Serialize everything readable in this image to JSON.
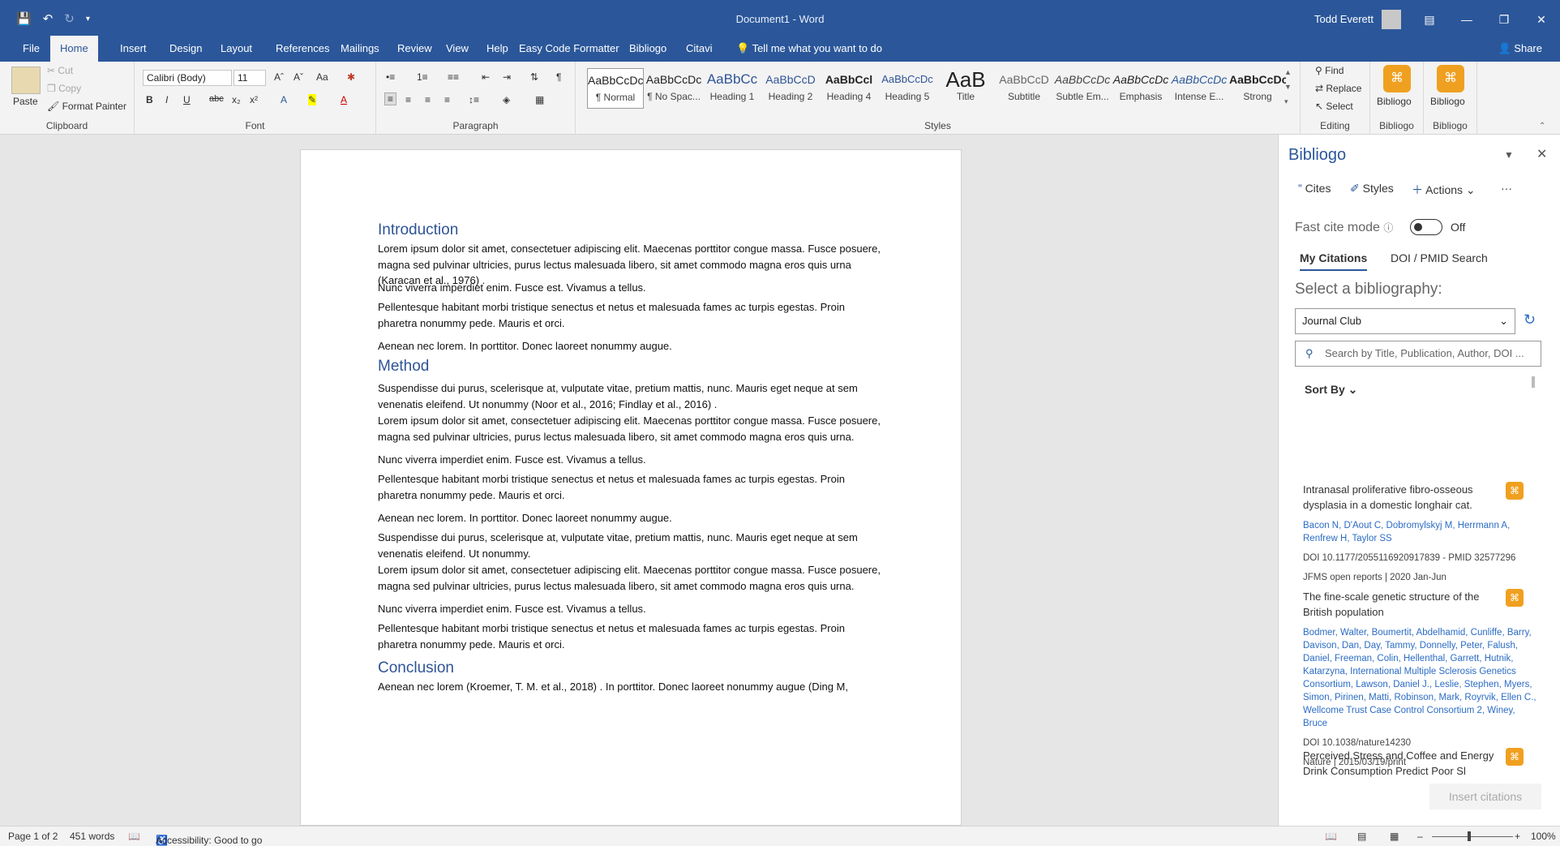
{
  "titlebar": {
    "document_title": "Document1 - Word",
    "user_name": "Todd Everett"
  },
  "tabs": [
    "File",
    "Home",
    "Insert",
    "Design",
    "Layout",
    "References",
    "Mailings",
    "Review",
    "View",
    "Help",
    "Easy Code Formatter",
    "Bibliogo",
    "Citavi"
  ],
  "tell_me": "Tell me what you want to do",
  "share": "Share",
  "ribbon": {
    "clipboard": {
      "paste": "Paste",
      "cut": "Cut",
      "copy": "Copy",
      "format_painter": "Format Painter",
      "label": "Clipboard"
    },
    "font": {
      "name": "Calibri (Body)",
      "size": "11",
      "label": "Font",
      "change_case": "Aa",
      "bold": "B",
      "italic": "I",
      "underline": "U"
    },
    "paragraph": {
      "label": "Paragraph"
    },
    "styles": {
      "label": "Styles",
      "items": [
        {
          "sample": "AaBbCcDc",
          "name": "¶ Normal"
        },
        {
          "sample": "AaBbCcDc",
          "name": "¶ No Spac..."
        },
        {
          "sample": "AaBbCc",
          "name": "Heading 1"
        },
        {
          "sample": "AaBbCcD",
          "name": "Heading 2"
        },
        {
          "sample": "AaBbCcl",
          "name": "Heading 4"
        },
        {
          "sample": "AaBbCcDc",
          "name": "Heading 5"
        },
        {
          "sample": "AaB",
          "name": "Title"
        },
        {
          "sample": "AaBbCcD",
          "name": "Subtitle"
        },
        {
          "sample": "AaBbCcDc",
          "name": "Subtle Em..."
        },
        {
          "sample": "AaBbCcDc",
          "name": "Emphasis"
        },
        {
          "sample": "AaBbCcDc",
          "name": "Intense E..."
        },
        {
          "sample": "AaBbCcDc",
          "name": "Strong"
        }
      ]
    },
    "editing": {
      "find": "Find",
      "replace": "Replace",
      "select": "Select",
      "label": "Editing"
    },
    "bibliogo1": {
      "button": "Bibliogo",
      "label": "Bibliogo"
    },
    "bibliogo2": {
      "button": "Bibliogo",
      "label": "Bibliogo"
    }
  },
  "document": {
    "blocks": [
      {
        "type": "h",
        "text": "Introduction"
      },
      {
        "type": "p",
        "text": "Lorem ipsum dolor sit amet, consectetuer adipiscing elit. Maecenas porttitor congue massa. Fusce posuere, magna sed pulvinar ultricies, purus lectus malesuada libero, sit amet commodo magna eros quis urna (Karacan et al., 1976) ."
      },
      {
        "type": "p",
        "text": "Nunc viverra imperdiet enim. Fusce est. Vivamus a tellus."
      },
      {
        "type": "p",
        "text": "Pellentesque habitant morbi tristique senectus et netus et malesuada fames ac turpis egestas. Proin pharetra nonummy pede. Mauris et orci."
      },
      {
        "type": "p",
        "text": "Aenean nec lorem. In porttitor. Donec laoreet nonummy augue."
      },
      {
        "type": "h",
        "text": "Method"
      },
      {
        "type": "p",
        "text": "Suspendisse dui purus, scelerisque at, vulputate vitae, pretium mattis, nunc. Mauris eget neque at sem venenatis eleifend. Ut nonummy (Noor et al., 2016; Findlay et al., 2016) ."
      },
      {
        "type": "p",
        "text": "Lorem ipsum dolor sit amet, consectetuer adipiscing elit. Maecenas porttitor congue massa. Fusce posuere, magna sed pulvinar ultricies, purus lectus malesuada libero, sit amet commodo magna eros quis urna."
      },
      {
        "type": "p",
        "text": "Nunc viverra imperdiet enim. Fusce est. Vivamus a tellus."
      },
      {
        "type": "p",
        "text": "Pellentesque habitant morbi tristique senectus et netus et malesuada fames ac turpis egestas. Proin pharetra nonummy pede. Mauris et orci."
      },
      {
        "type": "p",
        "text": "Aenean nec lorem. In porttitor. Donec laoreet nonummy augue."
      },
      {
        "type": "p",
        "text": "Suspendisse dui purus, scelerisque at, vulputate vitae, pretium mattis, nunc. Mauris eget neque at sem venenatis eleifend. Ut nonummy."
      },
      {
        "type": "p",
        "text": "Lorem ipsum dolor sit amet, consectetuer adipiscing elit. Maecenas porttitor congue massa. Fusce posuere, magna sed pulvinar ultricies, purus lectus malesuada libero, sit amet commodo magna eros quis urna."
      },
      {
        "type": "p",
        "text": "Nunc viverra imperdiet enim. Fusce est. Vivamus a tellus."
      },
      {
        "type": "p",
        "text": "Pellentesque habitant morbi tristique senectus et netus et malesuada fames ac turpis egestas. Proin pharetra nonummy pede. Mauris et orci."
      },
      {
        "type": "h",
        "text": "Conclusion"
      },
      {
        "type": "p",
        "text": "Aenean nec lorem (Kroemer, T. M. et al., 2018) . In porttitor. Donec laoreet nonummy augue (Ding M,"
      }
    ]
  },
  "pane": {
    "title": "Bibliogo",
    "cites": "Cites",
    "styles": "Styles",
    "actions": "Actions",
    "more": "···",
    "fast_cite_label": "Fast cite mode",
    "fast_cite_state": "Off",
    "tab_my_citations": "My Citations",
    "tab_doi_search": "DOI / PMID Search",
    "select_label": "Select a bibliography:",
    "selected_bibliography": "Journal Club",
    "search_placeholder": "Search by Title, Publication, Author, DOI ...",
    "sort_by": "Sort By",
    "citations": [
      {
        "title": "Intranasal proliferative fibro-osseous dysplasia in a domestic longhair cat.",
        "authors": "Bacon N, D'Aout C, Dobromylskyj M, Herrmann A, Renfrew H, Taylor SS",
        "ids": "DOI 10.1177/2055116920917839 - PMID 32577296",
        "source": "JFMS open reports | 2020 Jan-Jun"
      },
      {
        "title": "The fine-scale genetic structure of the British population",
        "authors": "Bodmer, Walter, Boumertit, Abdelhamid, Cunliffe, Barry, Davison, Dan, Day, Tammy, Donnelly, Peter, Falush, Daniel, Freeman, Colin, Hellenthal, Garrett, Hutnik, Katarzyna, International Multiple Sclerosis Genetics Consortium, Lawson, Daniel J., Leslie, Stephen, Myers, Simon, Pirinen, Matti, Robinson, Mark, Royrvik, Ellen C., Wellcome Trust Case Control Consortium 2, Winey, Bruce",
        "ids": "DOI 10.1038/nature14230",
        "source": "Nature | 2015/03/19/print"
      },
      {
        "title": "Perceived Stress and Coffee and Energy Drink Consumption Predict Poor Sl",
        "authors": "",
        "ids": "",
        "source": ""
      }
    ],
    "insert_button": "Insert citations"
  },
  "status": {
    "page": "Page 1 of 2",
    "words": "451 words",
    "accessibility": "Accessibility: Good to go",
    "zoom": "100%"
  },
  "colors": {
    "accent": "#2b579a",
    "heading": "#2f5496",
    "bibliogo_icon": "#f0a020",
    "link": "#2b6cc4"
  }
}
